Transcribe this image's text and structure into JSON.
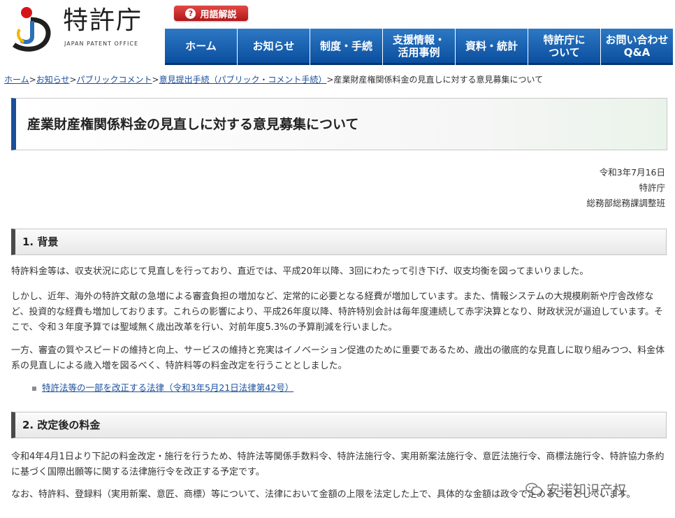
{
  "header": {
    "logo_name": "特許庁",
    "logo_sub": "JAPAN PATENT OFFICE",
    "glossary_label": "用語解説",
    "glossary_icon": "question-icon",
    "nav": [
      {
        "label_1": "ホーム",
        "label_2": ""
      },
      {
        "label_1": "お知らせ",
        "label_2": ""
      },
      {
        "label_1": "制度・手続",
        "label_2": ""
      },
      {
        "label_1": "支援情報・",
        "label_2": "活用事例"
      },
      {
        "label_1": "資料・統計",
        "label_2": ""
      },
      {
        "label_1": "特許庁に",
        "label_2": "ついて"
      },
      {
        "label_1": "お問い合わせ",
        "label_2": "Q&A"
      }
    ]
  },
  "breadcrumb": [
    "ホーム",
    "お知らせ",
    "パブリックコメント",
    "意見提出手続（パブリック・コメント手続）",
    "産業財産権関係料金の見直しに対する意見募集について"
  ],
  "breadcrumb_sep": ">",
  "title": "産業財産権関係料金の見直しに対する意見募集について",
  "dateblock": {
    "date": "令和3年7月16日",
    "org": "特許庁",
    "dept": "総務部総務課調整班"
  },
  "section1": {
    "heading": "1. 背景",
    "p1": "特許料金等は、収支状況に応じて見直しを行っており、直近では、平成20年以降、3回にわたって引き下げ、収支均衡を図ってまいりました。",
    "p2": "しかし、近年、海外の特許文献の急増による審査負担の増加など、定常的に必要となる経費が増加しています。また、情報システムの大規模刷新や庁舎改修など、投資的な経費も増加しております。これらの影響により、平成26年度以降、特許特別会計は毎年度連続して赤字決算となり、財政状況が逼迫しています。そこで、令和３年度予算では聖域無く歳出改革を行い、対前年度5.3%の予算削減を行いました。",
    "p3": "一方、審査の質やスピードの維持と向上、サービスの維持と充実はイノベーション促進のために重要であるため、歳出の徹底的な見直しに取り組みつつ、料金体系の見直しによる歳入増を図るべく、特許料等の料金改定を行うこととしました。",
    "link": "特許法等の一部を改正する法律（令和3年5月21日法律第42号）"
  },
  "section2": {
    "heading": "2. 改定後の料金",
    "p1": "令和4年4月1日より下記の料金改定・施行を行うため、特許法等関係手数料令、特許法施行令、実用新案法施行令、意匠法施行令、商標法施行令、特許協力条約に基づく国際出願等に関する法律施行令を改正する予定です。",
    "p2": "なお、特許料、登録料（実用新案、意匠、商標）等について、法律において金額の上限を法定した上で、具体的な金額は政令で定めることとしています。"
  },
  "watermark": "安诺知识产权",
  "colors": {
    "nav_blue": "#0b4f9f",
    "title_accent": "#1b4e99",
    "glossary_red": "#c2201f",
    "link": "#1a4f9c"
  }
}
